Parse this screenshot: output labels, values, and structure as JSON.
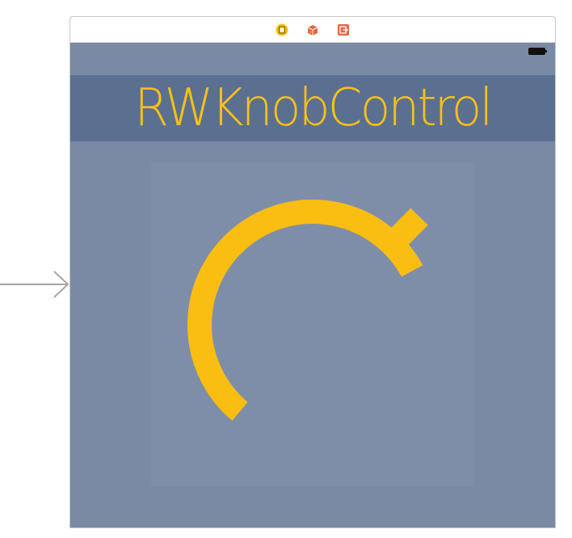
{
  "storyboard": {
    "entry_point": "initial-view-controller-arrow"
  },
  "scene": {
    "dock_icons": [
      "view-controller-icon",
      "first-responder-icon",
      "exit-icon"
    ],
    "status_bar": {
      "battery_icon": "battery-icon"
    },
    "title": "RWKnobControl"
  },
  "knob": {
    "value": 0.72,
    "track_color": "#fabe12",
    "background_color": "#7f8ea8"
  },
  "colors": {
    "scene_background": "#7a8aa4",
    "banner_background": "#5b6f91",
    "accent": "#f6c016"
  }
}
